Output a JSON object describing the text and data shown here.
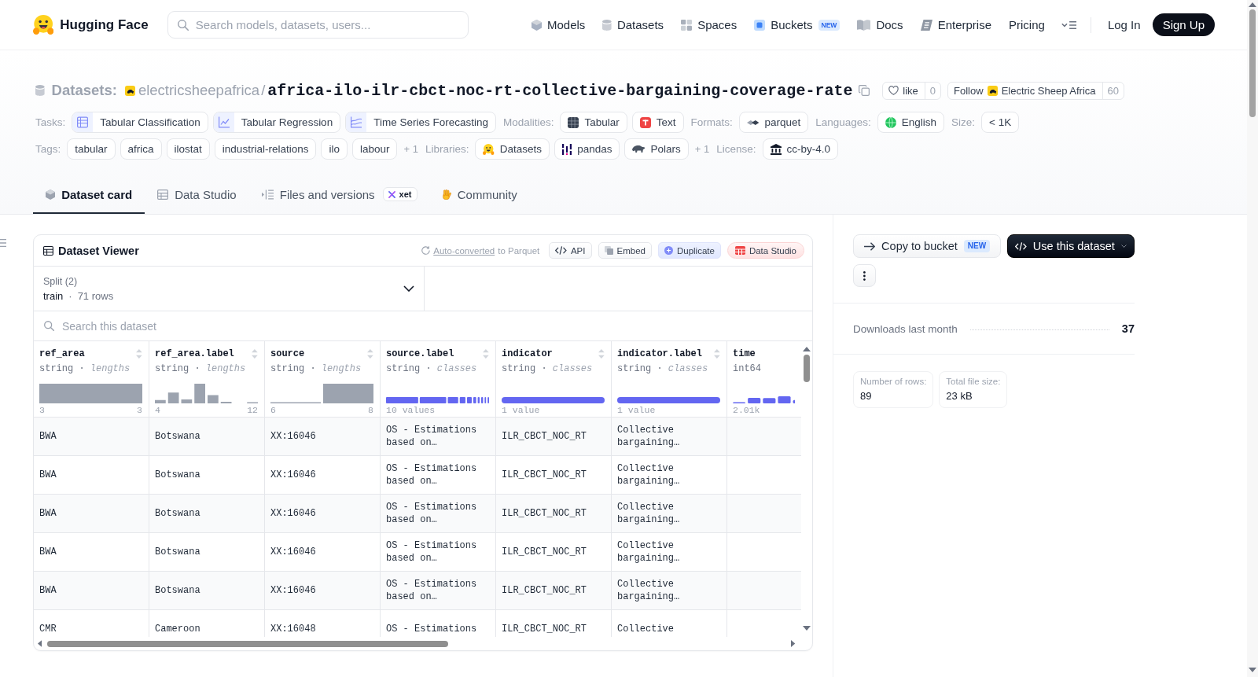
{
  "nav": {
    "brand": "Hugging Face",
    "search": {
      "placeholder": "Search models, datasets, users..."
    },
    "links": [
      {
        "label": "Models"
      },
      {
        "label": "Datasets"
      },
      {
        "label": "Spaces"
      },
      {
        "label": "Buckets",
        "badge": "NEW"
      },
      {
        "label": "Docs"
      },
      {
        "label": "Enterprise"
      },
      {
        "label": "Pricing"
      }
    ],
    "log_in": "Log In",
    "sign_up": "Sign Up"
  },
  "repo": {
    "section": "Datasets:",
    "owner": "electricsheepafrica",
    "separator": "/",
    "name": "africa-ilo-ilr-cbct-noc-rt-collective-bargaining-coverage-rate",
    "like": {
      "label": "like",
      "count": "0"
    },
    "follow": {
      "label": "Follow",
      "org": "Electric Sheep Africa",
      "count": "60"
    }
  },
  "meta_rows": [
    [
      {
        "label": "Tasks:",
        "kind": "tasks",
        "chips": [
          "Tabular Classification",
          "Tabular Regression",
          "Time Series Forecasting"
        ]
      },
      {
        "label": "Modalities:",
        "kind": "modalities",
        "chips": [
          "Tabular",
          "Text"
        ]
      },
      {
        "label": "Formats:",
        "kind": "formats",
        "chips": [
          "parquet"
        ]
      },
      {
        "label": "Languages:",
        "kind": "languages",
        "chips": [
          "English"
        ]
      },
      {
        "label": "Size:",
        "kind": "size",
        "chips": [
          "< 1K"
        ]
      }
    ],
    [
      {
        "label": "Tags:",
        "kind": "tags",
        "chips": [
          "tabular",
          "africa",
          "ilostat",
          "industrial-relations",
          "ilo",
          "labour"
        ],
        "more": "+ 1"
      },
      {
        "label": "Libraries:",
        "kind": "libraries",
        "chips": [
          "Datasets",
          "pandas",
          "Polars"
        ],
        "more": "+ 1"
      },
      {
        "label": "License:",
        "kind": "license",
        "chips": [
          "cc-by-4.0"
        ]
      }
    ]
  ],
  "tabs": [
    {
      "label": "Dataset card",
      "selected": true
    },
    {
      "label": "Data Studio",
      "selected": false
    },
    {
      "label": "Files and versions",
      "selected": false,
      "badge": "xet"
    },
    {
      "label": "Community",
      "selected": false
    }
  ],
  "viewer": {
    "title": "Dataset Viewer",
    "conversion": {
      "link": "Auto-converted",
      "text": "to Parquet"
    },
    "actions": [
      {
        "label": "API",
        "kind": "api"
      },
      {
        "label": "Embed",
        "kind": "embed"
      },
      {
        "label": "Duplicate",
        "kind": "duplicate"
      },
      {
        "label": "Data Studio",
        "kind": "studio"
      }
    ],
    "split": {
      "label": "Split (2)",
      "value": "train",
      "separator": "·",
      "rows": "71 rows"
    },
    "search": {
      "placeholder": "Search this dataset"
    },
    "columns": [
      {
        "name": "ref_area",
        "dtype": "string · *lengths*",
        "kind": "lengths",
        "range_start": "3",
        "range_end": "3"
      },
      {
        "name": "ref_area.label",
        "dtype": "string · *lengths*",
        "kind": "lengths",
        "range_start": "4",
        "range_end": "12"
      },
      {
        "name": "source",
        "dtype": "string · *lengths*",
        "kind": "lengths",
        "range_start": "6",
        "range_end": "8"
      },
      {
        "name": "source.label",
        "dtype": "string · *classes*",
        "kind": "classes",
        "summary": "10 values"
      },
      {
        "name": "indicator",
        "dtype": "string · *classes*",
        "kind": "classes",
        "summary": "1 value"
      },
      {
        "name": "indicator.label",
        "dtype": "string · *classes*",
        "kind": "classes",
        "summary": "1 value"
      },
      {
        "name": "time",
        "dtype": "int64",
        "kind": "numeric",
        "range_start": "2.01k"
      }
    ],
    "rows": [
      [
        "BWA",
        "Botswana",
        "XX:16046",
        "OS - Estimations based on…",
        "ILR_CBCT_NOC_RT",
        "Collective bargaining…"
      ],
      [
        "BWA",
        "Botswana",
        "XX:16046",
        "OS - Estimations based on…",
        "ILR_CBCT_NOC_RT",
        "Collective bargaining…"
      ],
      [
        "BWA",
        "Botswana",
        "XX:16046",
        "OS - Estimations based on…",
        "ILR_CBCT_NOC_RT",
        "Collective bargaining…"
      ],
      [
        "BWA",
        "Botswana",
        "XX:16046",
        "OS - Estimations based on…",
        "ILR_CBCT_NOC_RT",
        "Collective bargaining…"
      ],
      [
        "BWA",
        "Botswana",
        "XX:16046",
        "OS - Estimations based on…",
        "ILR_CBCT_NOC_RT",
        "Collective bargaining…"
      ],
      [
        "CMR",
        "Cameroon",
        "XX:16048",
        "OS - Estimations",
        "ILR_CBCT_NOC_RT",
        "Collective"
      ]
    ]
  },
  "sidebar": {
    "actions": [
      {
        "kind": "copy",
        "label": "Copy to bucket",
        "badge": "NEW"
      },
      {
        "kind": "use",
        "label": "Use this dataset"
      },
      {
        "kind": "more"
      }
    ],
    "downloads": {
      "label": "Downloads last month",
      "value": "37"
    },
    "stats": [
      {
        "label": "Number of rows:",
        "value": "89"
      },
      {
        "label": "Total file size:",
        "value": "23 kB"
      }
    ]
  }
}
